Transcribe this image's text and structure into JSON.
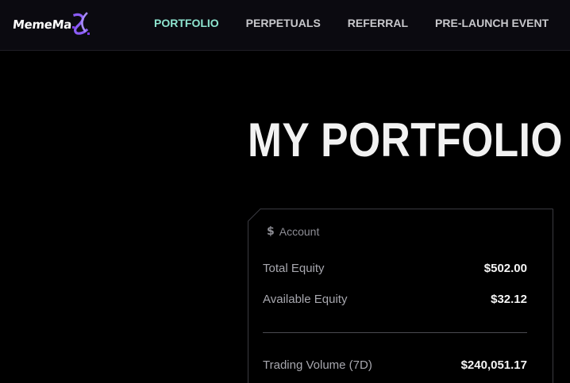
{
  "brand": {
    "name": "MemeMa",
    "mark_icon": "x-swirl-logo-icon",
    "mark_color": "#8b5cf6"
  },
  "nav": {
    "items": [
      {
        "label": "PORTFOLIO",
        "active": true
      },
      {
        "label": "PERPETUALS",
        "active": false
      },
      {
        "label": "REFERRAL",
        "active": false
      },
      {
        "label": "PRE-LAUNCH EVENT",
        "active": false
      }
    ],
    "active_color": "#8ee4cf"
  },
  "main": {
    "title": "MY PORTFOLIO"
  },
  "account": {
    "header_icon": "dollar-icon",
    "header_label": "Account",
    "rows": [
      {
        "label": "Total Equity",
        "value": "$502.00"
      },
      {
        "label": "Available Equity",
        "value": "$32.12"
      },
      {
        "label": "Trading Volume (7D)",
        "value": "$240,051.17"
      }
    ]
  }
}
